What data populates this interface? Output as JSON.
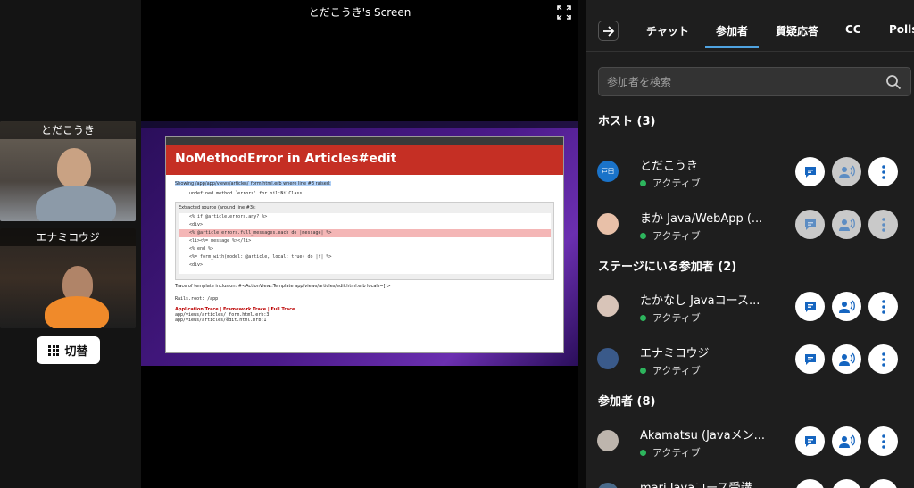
{
  "share": {
    "title": "とだこうき's Screen",
    "error_title": "NoMethodError in Articles#edit",
    "showing_line": "Showing /app/app/views/articles/_form.html.erb where line #3 raised:",
    "error_message": "undefined method `errors' for nil:NilClass",
    "extracted_label": "Extracted source (around line #3):",
    "code_lines": [
      "<% if @article.errors.any? %>",
      "<div>",
      "  <% @article.errors.full_messages.each do |message| %>",
      "    <li><%= message %></li>",
      "  <% end %>",
      "<%= form_with(model: @article, local: true) do |f| %>",
      "  <div>"
    ],
    "trace_line": "Trace of template inclusion: #<ActionView::Template app/views/articles/edit.html.erb locals=[]>",
    "rails_root": "Rails.root: /app",
    "trace_links": "Application Trace | Framework Trace | Full Trace",
    "trace_files": [
      "app/views/articles/_form.html.erb:3",
      "app/views/articles/edit.html.erb:1"
    ]
  },
  "cameras": [
    {
      "name": "とだこうき"
    },
    {
      "name": "エナミコウジ"
    }
  ],
  "switch_button": {
    "label": "切替"
  },
  "panel": {
    "tabs": [
      "チャット",
      "参加者",
      "質疑応答",
      "CC",
      "Polls"
    ],
    "active_tab": "参加者",
    "search_placeholder": "参加者を検索",
    "sections": {
      "hosts": "ホスト (3)",
      "stage": "ステージにいる参加者 (2)",
      "attendees": "参加者 (8)"
    },
    "participants": [
      {
        "name": "とだこうき",
        "status": "アクティブ",
        "avatar_text": "戸田"
      },
      {
        "name": "まか Java/WebApp (...",
        "status": "アクティブ",
        "avatar_text": ""
      },
      {
        "name": "たかなし Javaコース...",
        "status": "アクティブ",
        "avatar_text": ""
      },
      {
        "name": "エナミコウジ",
        "status": "アクティブ",
        "avatar_text": ""
      },
      {
        "name": "Akamatsu (Javaメン...",
        "status": "アクティブ",
        "avatar_text": ""
      },
      {
        "name": "mari Javaコース受講...",
        "status": "",
        "avatar_text": ""
      }
    ]
  },
  "colors": {
    "accent": "#4fa3e0",
    "status_active": "#2db55d",
    "error_red": "#c52f24"
  }
}
